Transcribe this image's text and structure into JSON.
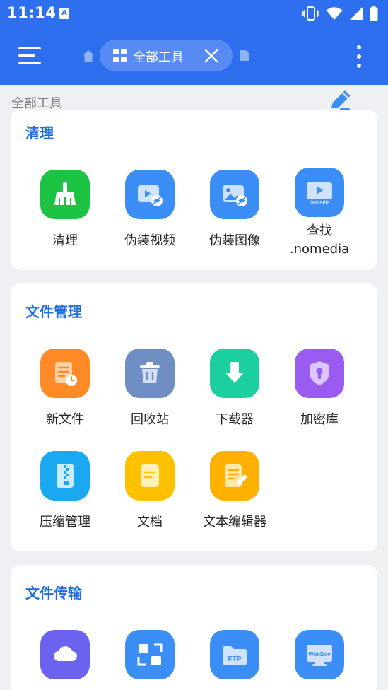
{
  "status_bar": {
    "time": "11:14",
    "notification_glyph": "A",
    "icons": [
      "vibrate-icon",
      "wifi-icon",
      "signal-icon",
      "battery-icon"
    ]
  },
  "app_bar": {
    "tab_label": "全部工具",
    "menu_icon": "hamburger-menu-icon",
    "more_icon": "more-vert-icon"
  },
  "header": {
    "title": "全部工具"
  },
  "sections": [
    {
      "title": "清理",
      "tools": [
        {
          "label": "清理",
          "icon": "broom-icon",
          "color": "#1dc443"
        },
        {
          "label": "伪装视频",
          "icon": "hidden-video-icon",
          "color": "#3b8ef5"
        },
        {
          "label": "伪装图像",
          "icon": "hidden-image-icon",
          "color": "#3b8ef5"
        },
        {
          "label": "查找 .nomedia",
          "icon": "nomedia-icon",
          "color": "#3b8ef5",
          "logo_text": "nomedia"
        }
      ]
    },
    {
      "title": "文件管理",
      "tools": [
        {
          "label": "新文件",
          "icon": "new-file-icon",
          "color": "#ff8a26"
        },
        {
          "label": "回收站",
          "icon": "trash-icon",
          "color": "#6f8fc4"
        },
        {
          "label": "下载器",
          "icon": "download-icon",
          "color": "#1ccfa0"
        },
        {
          "label": "加密库",
          "icon": "lock-shield-icon",
          "color": "#9a5bf0"
        },
        {
          "label": "压缩管理",
          "icon": "zip-icon",
          "color": "#1aa9f0"
        },
        {
          "label": "文档",
          "icon": "document-icon",
          "color": "#ffc000"
        },
        {
          "label": "文本编辑器",
          "icon": "text-editor-icon",
          "color": "#ffb000"
        }
      ]
    },
    {
      "title": "文件传输",
      "tools": [
        {
          "label": "",
          "icon": "cloud-icon",
          "color": "#6b63f0"
        },
        {
          "label": "",
          "icon": "transfer-icon",
          "color": "#3b8ef5"
        },
        {
          "label": "",
          "icon": "ftp-icon",
          "color": "#3b8ef5",
          "logo_text": "FTP"
        },
        {
          "label": "",
          "icon": "webdav-icon",
          "color": "#3b8ef5",
          "logo_text": "WebDav"
        }
      ]
    }
  ]
}
